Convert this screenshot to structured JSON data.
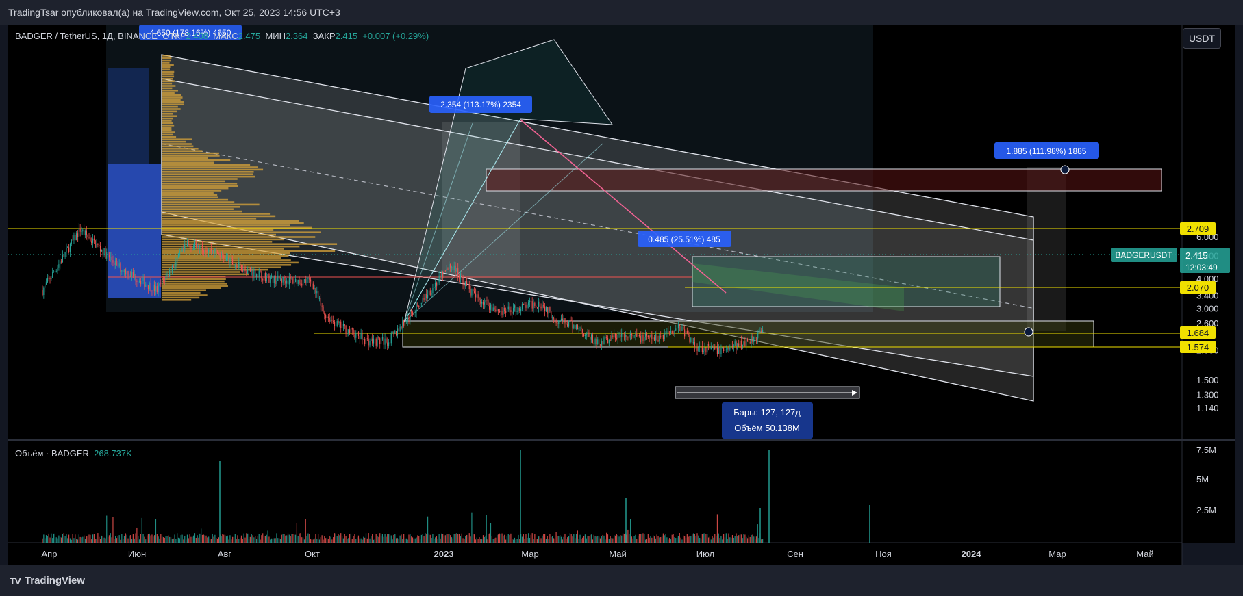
{
  "header": {
    "publisher_line": "TradingTsar опубликовал(а) на TradingView.com, Окт 25, 2023 14:56 UTC+3"
  },
  "legend": {
    "symbol": "BADGER / TetherUS, 1Д, BINANCE",
    "open_label": "ОТКР",
    "open_value": "2.408",
    "high_label": "МАКС",
    "high_value": "2.475",
    "low_label": "МИН",
    "low_value": "2.364",
    "close_label": "ЗАКР",
    "close_value": "2.415",
    "change": "+0.007 (+0.29%)"
  },
  "currency_button": "USDT",
  "volume_legend": {
    "label": "Объём · BADGER",
    "value": "268.737K"
  },
  "footer": {
    "brand": "TradingView",
    "brand_mark": "TV"
  },
  "colors": {
    "up": "#26a69a",
    "down": "#ef5350",
    "yellow": "#f0e000",
    "blue_label": "#2962ff",
    "volume_profile": "#d9a43a",
    "profile_blue": "#2b52c9"
  },
  "chart_data": {
    "type": "candlestick",
    "symbol": "BADGERUSDT",
    "interval": "1D",
    "price_axis": {
      "scale": "log",
      "ticks": [
        "6.000",
        "5.000",
        "4.000",
        "3.400",
        "3.000",
        "2.600",
        "2.000",
        "1.500",
        "1.300",
        "1.140"
      ]
    },
    "time_axis": {
      "ticks": [
        "Апр",
        "Июн",
        "Авг",
        "Окт",
        "2023",
        "Мар",
        "Май",
        "Июл",
        "Сен",
        "Ноя",
        "2024",
        "Мар",
        "Май"
      ]
    },
    "volume_axis": {
      "ticks": [
        "7.5M",
        "5M",
        "2.5M"
      ]
    },
    "last_price": {
      "symbol": "BADGERUSDT",
      "price": "2.415",
      "countdown": "12:03:49"
    },
    "horizontal_levels": [
      "2.709",
      "2.070",
      "1.684",
      "1.574"
    ],
    "measure_labels": [
      "4.650 (178.16%) 4650",
      "2.354 (113.17%) 2354",
      "0.485 (25.51%) 485",
      "1.885 (111.98%) 1885"
    ],
    "range_tool": {
      "bars": "Бары: 127, 127д",
      "volume": "Объём 50.138M"
    },
    "price_path": [
      [
        "2022-04",
        3.6
      ],
      [
        "2022-05",
        6.5
      ],
      [
        "2022-06",
        4.5
      ],
      [
        "2022-07",
        3.6
      ],
      [
        "2022-07-25",
        5.6
      ],
      [
        "2022-08-15",
        5.3
      ],
      [
        "2022-09",
        4.6
      ],
      [
        "2022-10",
        4.0
      ],
      [
        "2022-11-01",
        3.9
      ],
      [
        "2022-11-10",
        2.9
      ],
      [
        "2022-11-20",
        2.6
      ],
      [
        "2022-12-15",
        2.2
      ],
      [
        "2023-01-01",
        2.2
      ],
      [
        "2023-01-15",
        2.7
      ],
      [
        "2023-02-01",
        3.5
      ],
      [
        "2023-02-20",
        4.6
      ],
      [
        "2023-03-10",
        3.4
      ],
      [
        "2023-04-01",
        2.9
      ],
      [
        "2023-05-01",
        3.2
      ],
      [
        "2023-05-15",
        2.7
      ],
      [
        "2023-06-01",
        2.5
      ],
      [
        "2023-06-15",
        2.15
      ],
      [
        "2023-07-01",
        2.3
      ],
      [
        "2023-08-01",
        2.25
      ],
      [
        "2023-08-20",
        2.55
      ],
      [
        "2023-09-01",
        2.1
      ],
      [
        "2023-09-20",
        2.0
      ],
      [
        "2023-10-10",
        2.15
      ],
      [
        "2023-10-25",
        2.415
      ]
    ]
  }
}
